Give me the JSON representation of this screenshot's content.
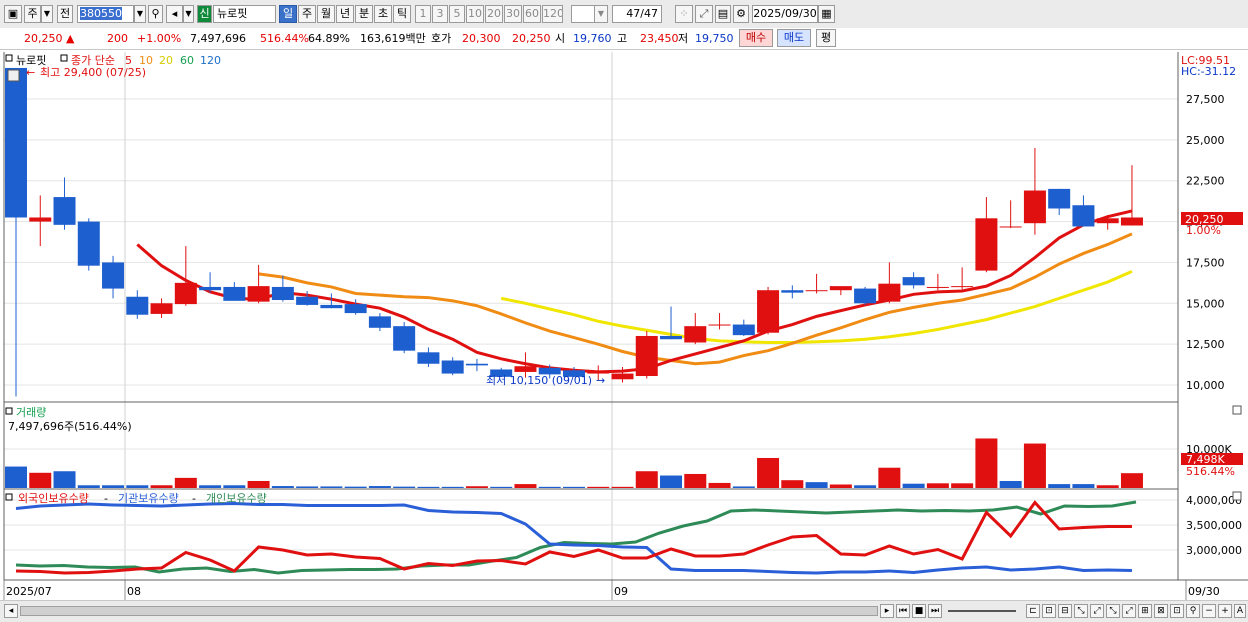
{
  "toolbar": {
    "period_type": "주",
    "market": "전",
    "stock_code": "380550",
    "stock_tag": "신",
    "stock_name": "뉴로핏",
    "periods": [
      "일",
      "주",
      "월",
      "년",
      "분",
      "초",
      "틱"
    ],
    "active_period": "일",
    "numbers": [
      "1",
      "3",
      "5",
      "10",
      "20",
      "30",
      "60",
      "120"
    ],
    "count": "47",
    "count_total": "/47",
    "date": "2025/09/30"
  },
  "info": {
    "price": "20,250",
    "change": "200",
    "change_pct": "+1.00%",
    "volume": "7,497,696",
    "volume_pct": "516.44%",
    "ratio": "64.89%",
    "amount": "163,619백만",
    "ask_label": "호가",
    "ask": "20,300",
    "bid": "20,250",
    "open_label": "시",
    "open": "19,760",
    "high_label": "고",
    "high": "23,450",
    "low_label": "저",
    "low": "19,750",
    "buy": "매수",
    "sell": "매도",
    "avg": "평"
  },
  "legend": {
    "stock": "뉴로핏",
    "ma_title": "종가 단순",
    "ma_periods": [
      "5",
      "10",
      "20",
      "60",
      "120"
    ],
    "ma_colors": [
      "#e01010",
      "#f08c14",
      "#e8e000",
      "#15a050",
      "#1e6ec8"
    ],
    "high_note": "최고 29,400 (07/25)",
    "low_note": "최저 10,150 (09/01)",
    "lc": "LC:99.51",
    "hc": "HC:-31.12",
    "price_tag": "20,250",
    "price_pct": "1.00%",
    "volume_title": "거래량",
    "volume_value": "7,497,696주(516.44%)",
    "volume_tag": "7,498K",
    "volume_tag_pct": "516.44%",
    "holding_titles": [
      "외국인보유수량",
      "기관보유수량",
      "개인보유수량"
    ],
    "holding_colors": [
      "#e01010",
      "#2a5fd8",
      "#2e8b57"
    ]
  },
  "axis": {
    "price_ticks": [
      "27,500",
      "25,000",
      "22,500",
      "20,000",
      "17,500",
      "15,000",
      "12,500",
      "10,000"
    ],
    "volume_ticks": [
      "10,000K"
    ],
    "holding_ticks": [
      "4,000,000",
      "3,500,000",
      "3,000,000"
    ],
    "x_labels": [
      "2025/07",
      "08",
      "09",
      "09/30"
    ]
  },
  "chart_data": {
    "type": "candlestick",
    "y_range": [
      9000,
      30200
    ],
    "candles": [
      [
        29400,
        29400,
        9300,
        20250
      ],
      [
        20000,
        21600,
        18500,
        20250
      ],
      [
        21500,
        22700,
        19500,
        19800
      ],
      [
        20000,
        20200,
        17000,
        17300
      ],
      [
        17500,
        17900,
        15300,
        15900
      ],
      [
        15400,
        15800,
        14050,
        14300
      ],
      [
        14350,
        15300,
        14100,
        15000
      ],
      [
        14950,
        18500,
        14850,
        16250
      ],
      [
        16000,
        16900,
        15650,
        15800
      ],
      [
        16000,
        16300,
        15300,
        15150
      ],
      [
        15100,
        17350,
        15000,
        16050
      ],
      [
        16000,
        16700,
        15100,
        15200
      ],
      [
        15400,
        15750,
        14850,
        14900
      ],
      [
        14900,
        15600,
        14700,
        14700
      ],
      [
        14950,
        15250,
        14300,
        14400
      ],
      [
        14200,
        14400,
        13300,
        13500
      ],
      [
        13600,
        13850,
        11950,
        12100
      ],
      [
        12000,
        12300,
        11100,
        11300
      ],
      [
        11500,
        11700,
        10600,
        10700
      ],
      [
        11300,
        11600,
        10850,
        11200
      ],
      [
        10950,
        11050,
        10500,
        10500
      ],
      [
        10800,
        12000,
        10450,
        11150
      ],
      [
        11050,
        11250,
        10400,
        10650
      ],
      [
        10900,
        11100,
        10500,
        10500
      ],
      [
        10700,
        11200,
        10300,
        10800
      ],
      [
        10350,
        11100,
        10150,
        10700
      ],
      [
        10550,
        13300,
        10400,
        13000
      ],
      [
        13000,
        14800,
        12800,
        12800
      ],
      [
        12600,
        14400,
        12500,
        13600
      ],
      [
        13700,
        14400,
        13400,
        13700
      ],
      [
        13700,
        14000,
        13000,
        13050
      ],
      [
        13200,
        16000,
        13100,
        15800
      ],
      [
        15800,
        16100,
        15300,
        15650
      ],
      [
        15800,
        16800,
        15600,
        15800
      ],
      [
        15800,
        16000,
        15500,
        16050
      ],
      [
        15900,
        16000,
        14900,
        15000
      ],
      [
        15100,
        17500,
        15000,
        16200
      ],
      [
        16600,
        16900,
        15900,
        16100
      ],
      [
        16000,
        16800,
        15800,
        16000
      ],
      [
        16000,
        17200,
        15850,
        16050
      ],
      [
        17000,
        21500,
        16900,
        20200
      ],
      [
        19700,
        21300,
        19600,
        19700
      ],
      [
        19900,
        24500,
        19200,
        21900
      ],
      [
        22000,
        22000,
        20400,
        20800
      ],
      [
        21000,
        21600,
        20000,
        19700
      ],
      [
        19900,
        20400,
        19500,
        20200
      ],
      [
        19760,
        23450,
        19750,
        20250
      ]
    ],
    "ma5": [
      null,
      null,
      null,
      null,
      null,
      18600,
      17300,
      16400,
      15700,
      15300,
      15250,
      15650,
      15500,
      15250,
      14950,
      14700,
      14150,
      13400,
      12800,
      12000,
      11600,
      11300,
      11050,
      10900,
      10800,
      10850,
      11000,
      11500,
      11900,
      12300,
      12700,
      13300,
      13700,
      14200,
      14550,
      14900,
      15200,
      15550,
      15700,
      15750,
      16050,
      16700,
      17800,
      19000,
      19800,
      20300,
      20650
    ],
    "ma10": [
      null,
      null,
      null,
      null,
      null,
      null,
      null,
      null,
      null,
      null,
      16800,
      16600,
      16250,
      16000,
      15600,
      15500,
      15400,
      15350,
      15150,
      14850,
      14350,
      13800,
      13300,
      12900,
      12500,
      12050,
      11700,
      11500,
      11300,
      11400,
      11800,
      12100,
      12550,
      13050,
      13500,
      14000,
      14450,
      14750,
      15000,
      15200,
      15550,
      15900,
      16600,
      17400,
      18050,
      18600,
      19250
    ],
    "ma20": [
      null,
      null,
      null,
      null,
      null,
      null,
      null,
      null,
      null,
      null,
      null,
      null,
      null,
      null,
      null,
      null,
      null,
      null,
      null,
      null,
      15300,
      15000,
      14650,
      14300,
      13900,
      13600,
      13350,
      13100,
      12850,
      12700,
      12650,
      12600,
      12600,
      12650,
      12700,
      12800,
      12950,
      13150,
      13400,
      13700,
      14000,
      14400,
      14800,
      15300,
      15800,
      16300,
      16950
    ],
    "volume_k": [
      5500,
      3900,
      4300,
      700,
      700,
      700,
      700,
      2600,
      700,
      700,
      1800,
      500,
      400,
      400,
      350,
      500,
      350,
      300,
      300,
      450,
      300,
      1000,
      300,
      300,
      300,
      300,
      4300,
      3200,
      3600,
      1300,
      400,
      7700,
      2000,
      1500,
      900,
      700,
      5200,
      1100,
      1200,
      1200,
      12700,
      1800,
      11400,
      1000,
      1000,
      700,
      3800
    ],
    "volume_up": [
      false,
      true,
      false,
      false,
      false,
      false,
      true,
      true,
      false,
      false,
      true,
      false,
      false,
      false,
      false,
      false,
      false,
      false,
      false,
      true,
      false,
      true,
      false,
      false,
      true,
      true,
      true,
      false,
      true,
      true,
      false,
      true,
      true,
      false,
      true,
      false,
      true,
      false,
      true,
      true,
      true,
      false,
      true,
      false,
      false,
      true,
      true
    ],
    "foreign": [
      2580000,
      2570000,
      2540000,
      2550000,
      2580000,
      2620000,
      2640000,
      2950000,
      2800000,
      2580000,
      3060000,
      3000000,
      2900000,
      2920000,
      2860000,
      2830000,
      2620000,
      2730000,
      2690000,
      2780000,
      2790000,
      2720000,
      2960000,
      2870000,
      3000000,
      2840000,
      2840000,
      3020000,
      2880000,
      2880000,
      2920000,
      3100000,
      3260000,
      3290000,
      2920000,
      2900000,
      3080000,
      2920000,
      3010000,
      2820000,
      3750000,
      3280000,
      3950000,
      3420000,
      3450000,
      3470000,
      3470000
    ],
    "institution": [
      3830000,
      3880000,
      3900000,
      3920000,
      3900000,
      3890000,
      3880000,
      3900000,
      3920000,
      3930000,
      3910000,
      3910000,
      3890000,
      3890000,
      3890000,
      3890000,
      3900000,
      3790000,
      3760000,
      3750000,
      3730000,
      3520000,
      3120000,
      3100000,
      3090000,
      3060000,
      3050000,
      2620000,
      2590000,
      2590000,
      2590000,
      2570000,
      2550000,
      2540000,
      2560000,
      2560000,
      2580000,
      2550000,
      2600000,
      2640000,
      2660000,
      2600000,
      2620000,
      2660000,
      2590000,
      2600000,
      2590000
    ],
    "individual": [
      2700000,
      2680000,
      2690000,
      2660000,
      2650000,
      2660000,
      2560000,
      2620000,
      2640000,
      2570000,
      2610000,
      2540000,
      2590000,
      2600000,
      2610000,
      2610000,
      2620000,
      2680000,
      2700000,
      2700000,
      2780000,
      2850000,
      3050000,
      3150000,
      3130000,
      3120000,
      3160000,
      3340000,
      3480000,
      3580000,
      3780000,
      3800000,
      3780000,
      3760000,
      3740000,
      3760000,
      3780000,
      3800000,
      3780000,
      3790000,
      3780000,
      3800000,
      3860000,
      3720000,
      3880000,
      3870000,
      3880000,
      3960000
    ],
    "holding_range": [
      2400000,
      4200000
    ]
  }
}
